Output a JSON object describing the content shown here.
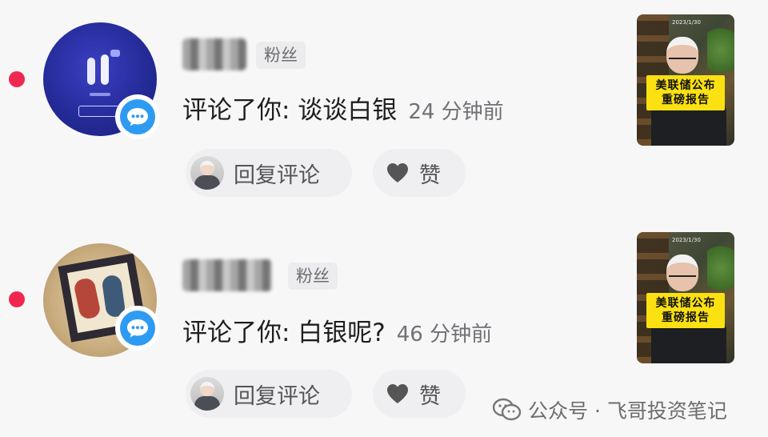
{
  "colors": {
    "unread_dot": "#f0284f",
    "badge_blue": "#2e9bf2",
    "thumb_caption_bg": "#fbe112",
    "pill_bg": "#efeff1"
  },
  "notifications": [
    {
      "tag": "粉丝",
      "comment": "评论了你: 谈谈白银",
      "time": "24 分钟前",
      "reply_label": "回复评论",
      "like_label": "赞",
      "thumb_caption_line1": "美联储公布",
      "thumb_caption_line2": "重磅报告",
      "thumb_tiny_text": "2023/1/30"
    },
    {
      "tag": "粉丝",
      "comment": "评论了你: 白银呢?",
      "time": "46 分钟前",
      "reply_label": "回复评论",
      "like_label": "赞",
      "thumb_caption_line1": "美联储公布",
      "thumb_caption_line2": "重磅报告",
      "thumb_tiny_text": "2023/1/30"
    }
  ],
  "watermark": {
    "text": "公众号 · 飞哥投资笔记",
    "icon": "wechat-icon"
  }
}
